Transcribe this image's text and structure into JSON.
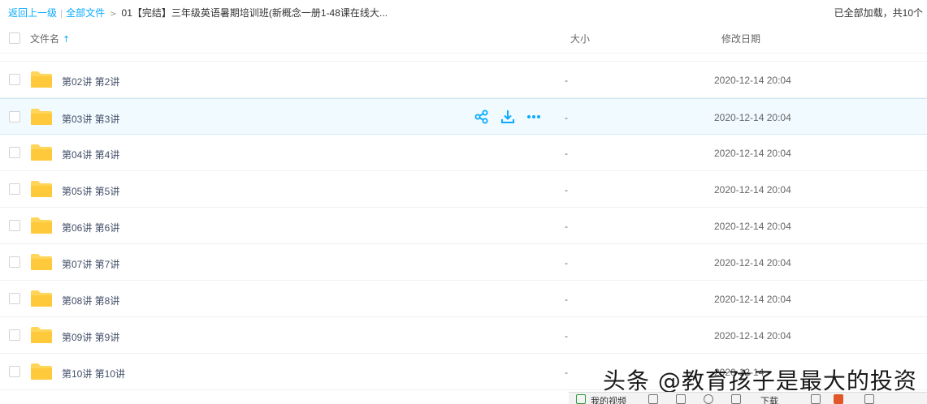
{
  "breadcrumb": {
    "back_label": "返回上一级",
    "all_files_label": "全部文件",
    "separator": "|",
    "arrow": ">",
    "current": "01【完结】三年级英语暑期培训班(新概念一册1-48课在线大..."
  },
  "status": {
    "loaded_text": "已全部加载，共10个"
  },
  "columns": {
    "name": "文件名",
    "size": "大小",
    "date": "修改日期",
    "sort_arrow": "↑"
  },
  "rows": [
    {
      "name": "第02讲 第2讲",
      "size": "-",
      "date": "2020-12-14 20:04"
    },
    {
      "name": "第03讲 第3讲",
      "size": "-",
      "date": "2020-12-14 20:04"
    },
    {
      "name": "第04讲 第4讲",
      "size": "-",
      "date": "2020-12-14 20:04"
    },
    {
      "name": "第05讲 第5讲",
      "size": "-",
      "date": "2020-12-14 20:04"
    },
    {
      "name": "第06讲 第6讲",
      "size": "-",
      "date": "2020-12-14 20:04"
    },
    {
      "name": "第07讲 第7讲",
      "size": "-",
      "date": "2020-12-14 20:04"
    },
    {
      "name": "第08讲 第8讲",
      "size": "-",
      "date": "2020-12-14 20:04"
    },
    {
      "name": "第09讲 第9讲",
      "size": "-",
      "date": "2020-12-14 20:04"
    },
    {
      "name": "第10讲 第10讲",
      "size": "-",
      "date": "2020-12-14"
    }
  ],
  "hovered_row": 1,
  "row_actions": [
    "share-icon",
    "download-icon",
    "more-icon"
  ],
  "watermark": "头条 @教育孩子是最大的投资",
  "bottom_bar": {
    "video_label": "我的视频",
    "download_label": "下载"
  },
  "colors": {
    "accent": "#09aaff",
    "folder": "#ffd659",
    "hover_bg": "#f0faff"
  }
}
